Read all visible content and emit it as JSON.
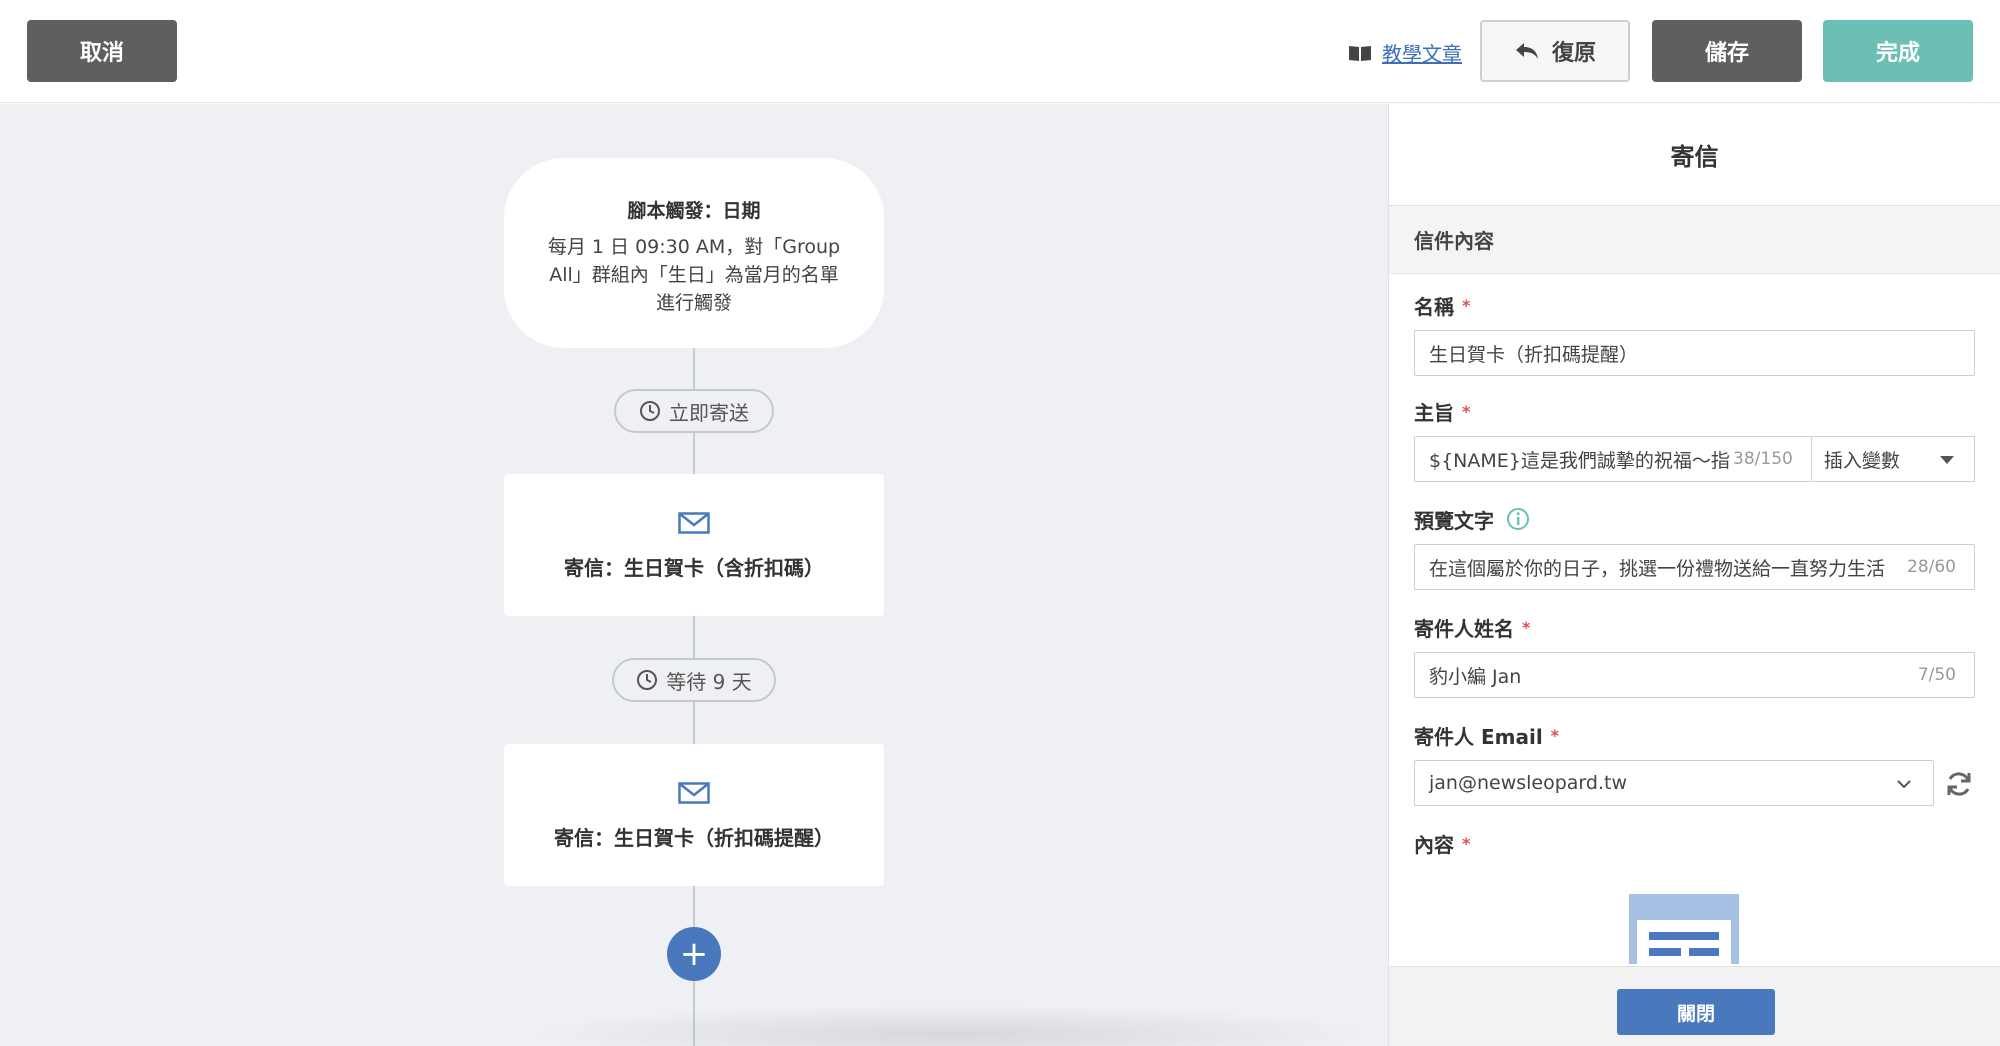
{
  "toolbar": {
    "cancel_label": "取消",
    "tutorial_label": "教學文章",
    "undo_label": "復原",
    "save_label": "儲存",
    "done_label": "完成"
  },
  "flow": {
    "trigger": {
      "title": "腳本觸發：日期",
      "description": "每月 1 日 09:30 AM，對「Group All」群組內「生日」為當月的名單進行觸發"
    },
    "delay1": "立即寄送",
    "mail1": "寄信：生日賀卡（含折扣碼）",
    "delay2": "等待 9 天",
    "mail2": "寄信：生日賀卡（折扣碼提醒）",
    "add_label": "+"
  },
  "panel": {
    "title": "寄信",
    "section": "信件內容",
    "fields": {
      "name": {
        "label": "名稱",
        "value": "生日賀卡（折扣碼提醒）"
      },
      "subject": {
        "label": "主旨",
        "value": "${NAME}這是我們誠摯的祝福～指",
        "counter": "38/150",
        "insert_label": "插入變數"
      },
      "preview": {
        "label": "預覽文字",
        "value": "在這個屬於你的日子，挑選一份禮物送給一直努力生活",
        "counter": "28/60"
      },
      "sender_name": {
        "label": "寄件人姓名",
        "value": "豹小編 Jan",
        "counter": "7/50"
      },
      "sender_email": {
        "label": "寄件人 Email",
        "value": "jan@newsleopard.tw"
      },
      "content": {
        "label": "內容"
      }
    },
    "required_mark": "*",
    "close_label": "關閉"
  },
  "colors": {
    "primary": "#4a78bd",
    "done": "#6cbfb4",
    "dark_button": "#5f5f5f",
    "canvas_bg": "#eef0f3",
    "required": "#e05050"
  }
}
